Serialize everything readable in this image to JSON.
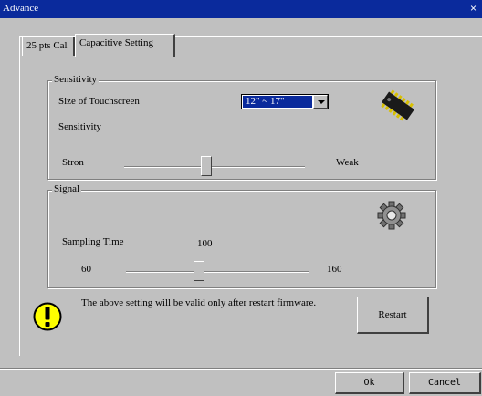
{
  "window": {
    "title": "Advance",
    "close_glyph": "×"
  },
  "tabs": [
    {
      "label": "25 pts Cal",
      "active": false
    },
    {
      "label": "Capacitive Setting",
      "active": true
    }
  ],
  "sensitivity_group": {
    "title": "Sensitivity",
    "size_label": "Size of Touchscreen",
    "size_value": "12\" ~ 17\"",
    "sensitivity_label": "Sensitivity",
    "left_label": "Stron",
    "right_label": "Weak",
    "icon": "chip-icon"
  },
  "signal_group": {
    "title": "Signal",
    "sampling_label": "Sampling Time",
    "current_value": "100",
    "min_label": "60",
    "max_label": "160",
    "icon": "gear-icon"
  },
  "notice": {
    "text": "The above setting will be valid only after restart firmware.",
    "icon": "warning-icon"
  },
  "buttons": {
    "restart": "Restart",
    "ok": "Ok",
    "cancel": "Cancel"
  },
  "colors": {
    "titlebar": "#0a2a9c",
    "face": "#c0c0c0",
    "warning": "#ffff00"
  }
}
